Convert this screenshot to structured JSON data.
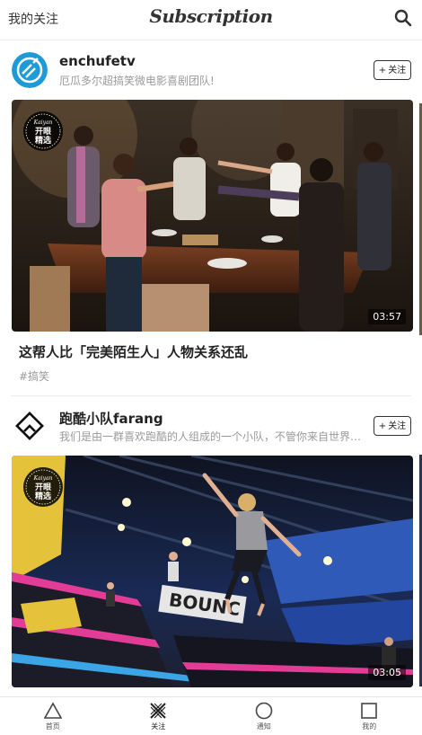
{
  "header": {
    "left_label": "我的关注",
    "title": "Subscription",
    "search_icon": "search-icon"
  },
  "feed": {
    "cards": [
      {
        "channel_name": "enchufetv",
        "channel_desc": "厄瓜多尔超搞笑微电影喜剧团队!",
        "follow_label": "关注",
        "follow_plus": "+",
        "badge_line1": "Kaiyan",
        "badge_line2": "开眼",
        "badge_line3": "精选",
        "duration": "03:57",
        "title": "这帮人比「完美陌生人」人物关系还乱",
        "tag": "#搞笑"
      },
      {
        "channel_name": "跑酷小队farang",
        "channel_desc": "我们是由一群喜欢跑酷的人组成的一个小队，不管你来自世界…",
        "follow_label": "关注",
        "follow_plus": "+",
        "badge_line1": "Kaiyan",
        "badge_line2": "开眼",
        "badge_line3": "精选",
        "duration": "03:05",
        "title": "",
        "tag": ""
      }
    ]
  },
  "bottom_nav": {
    "items": [
      {
        "label": "首页",
        "icon": "triangle-icon"
      },
      {
        "label": "关注",
        "icon": "x-mark-icon"
      },
      {
        "label": "通知",
        "icon": "circle-icon"
      },
      {
        "label": "我的",
        "icon": "square-icon"
      }
    ],
    "active_index": 1
  }
}
